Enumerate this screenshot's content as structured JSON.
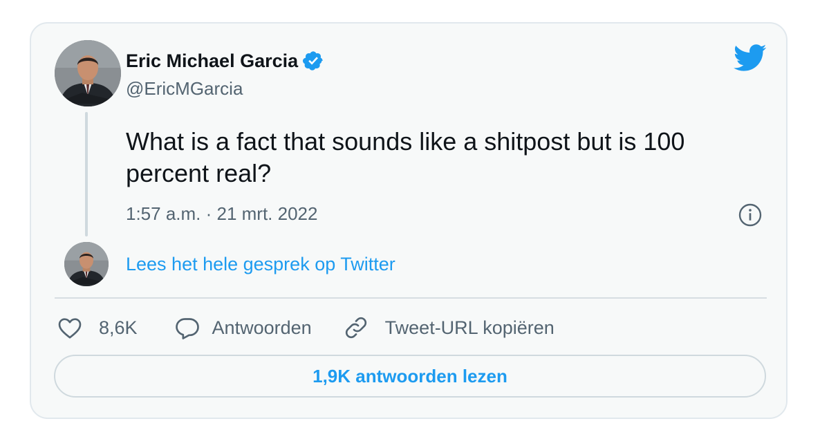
{
  "author": {
    "name": "Eric Michael Garcia",
    "handle": "@EricMGarcia",
    "verified": true
  },
  "tweet": {
    "text": "What is a fact that sounds like a shitpost but is 100 percent real?",
    "timestamp": "1:57 a.m. · 21 mrt. 2022"
  },
  "thread": {
    "read_link": "Lees het hele gesprek op Twitter"
  },
  "actions": {
    "like_count": "8,6K",
    "reply_label": "Antwoorden",
    "copy_label": "Tweet-URL kopiëren"
  },
  "footer": {
    "read_replies_label": "1,9K antwoorden lezen"
  },
  "icons": {
    "brand": "twitter-bird-icon",
    "verified": "verified-badge-icon",
    "info": "info-icon",
    "like": "heart-icon",
    "reply": "speech-bubble-icon",
    "copy": "link-icon"
  },
  "colors": {
    "accent": "#1d9bf0",
    "text": "#0f1419",
    "muted": "#536471",
    "card_bg": "#f7f9f9",
    "border": "#e1e8ed"
  }
}
